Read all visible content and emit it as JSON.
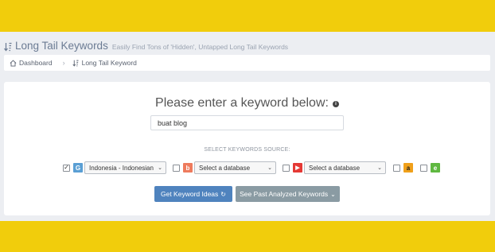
{
  "header": {
    "title": "Long Tail Keywords",
    "subtitle": "Easily Find Tons of 'Hidden', Untapped Long Tail Keywords"
  },
  "breadcrumb": {
    "items": [
      {
        "label": "Dashboard",
        "icon": "home-icon"
      },
      {
        "label": "Long Tail Keyword",
        "icon": "sort-icon"
      }
    ]
  },
  "main": {
    "prompt": "Please enter a keyword below:",
    "info_glyph": "i",
    "keyword_input": {
      "value": "buat blog",
      "placeholder": ""
    },
    "sources_label": "SELECT KEYWORDS SOURCE:",
    "sources": [
      {
        "name": "google",
        "checked": true,
        "check_glyph": "✓",
        "icon_glyph": "G",
        "icon_color": "#5a9fd4",
        "select_value": "Indonesia - Indonesian"
      },
      {
        "name": "bing",
        "checked": false,
        "icon_glyph": "b",
        "icon_color": "#ee7b5d",
        "select_value": "Select a database"
      },
      {
        "name": "youtube",
        "checked": false,
        "icon_glyph": "▶",
        "icon_color": "#e53935",
        "select_value": "Select a database"
      },
      {
        "name": "amazon",
        "checked": false,
        "icon_glyph": "a",
        "icon_color": "#f0a01a"
      },
      {
        "name": "ebay",
        "checked": false,
        "icon_glyph": "e",
        "icon_color": "#5fb840"
      }
    ],
    "select_chevron": "⌄",
    "buttons": {
      "primary": {
        "label": "Get Keyword Ideas",
        "icon_glyph": "↻",
        "color": "#4f83be"
      },
      "secondary": {
        "label": "See Past Analyzed Keywords",
        "icon_glyph": "⌄",
        "color": "#8a9ba3"
      }
    }
  },
  "colors": {
    "background": "#f1cd0c",
    "panel": "#eceef2",
    "card": "#ffffff"
  }
}
